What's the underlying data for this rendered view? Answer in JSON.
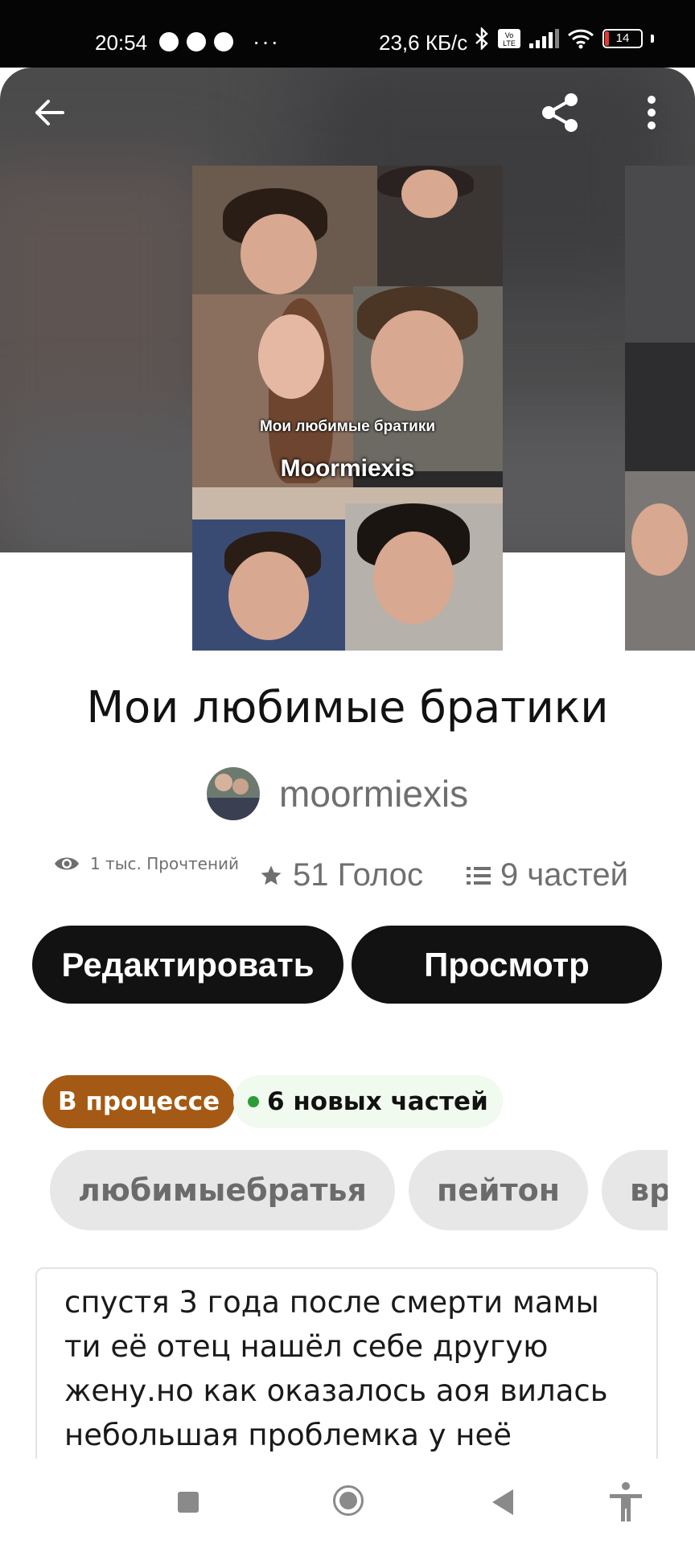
{
  "status_bar": {
    "time": "20:54",
    "speed": "23,6 КБ/с",
    "battery": "14",
    "icons_left": [
      "chat-bubble-icon",
      "pinterest-icon",
      "heart-app-icon",
      "more-dots-icon"
    ],
    "icons_right": [
      "bluetooth-icon",
      "volte-icon",
      "signal-icon",
      "wifi-icon",
      "battery-icon"
    ]
  },
  "header": {
    "back_icon": "arrow-left-icon",
    "share_icon": "share-icon",
    "menu_icon": "more-vertical-icon"
  },
  "cover": {
    "title_line": "Мои любимые братики",
    "author_line": "Moormiexis"
  },
  "story": {
    "title": "Мои любимые братики",
    "author": "moormiexis",
    "reads": "1 тыс. Прочтений",
    "votes": "51 Голос",
    "parts": "9 частей"
  },
  "actions": {
    "edit_label": "Редактировать",
    "view_label": "Просмотр"
  },
  "status": {
    "progress_label": "В процессе",
    "new_parts_label": "6 новых частей"
  },
  "tags": [
    "любимыебратья",
    "пейтон",
    "врачи"
  ],
  "description": "спустя 3 года после смерти мамы\nти её отец нашёл себе другую\nжену.но как оказалось аоя вилась\nнебольшая проблемка у неё",
  "nav": {
    "recents_icon": "square-recents-icon",
    "home_icon": "home-circle-icon",
    "back_icon": "triangle-back-icon",
    "accessibility_icon": "accessibility-icon"
  },
  "colors": {
    "progress_badge": "#a45a14",
    "new_parts_dot": "#2e9b3a",
    "button_bg": "#121212"
  }
}
